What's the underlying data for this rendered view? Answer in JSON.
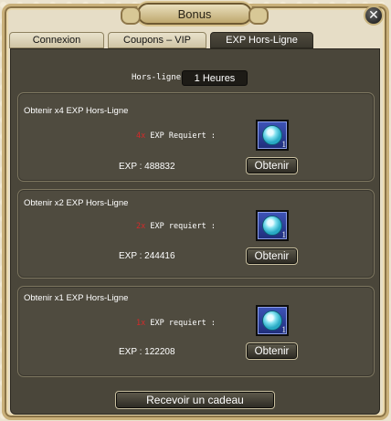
{
  "window": {
    "title": "Bonus",
    "close_icon": "close-icon"
  },
  "tabs": [
    {
      "label": "Connexion",
      "active": false
    },
    {
      "label": "Coupons – VIP",
      "active": false
    },
    {
      "label": "EXP Hors-Ligne",
      "active": true
    }
  ],
  "hours": {
    "label": "Hors-ligne",
    "value": "1 Heures"
  },
  "offers": [
    {
      "title": "Obtenir x4 EXP Hors-Ligne",
      "req_num": "4x",
      "req_text": "EXP Requiert :",
      "exp_text": "EXP : 488832",
      "item_qty": "1",
      "button": "Obtenir"
    },
    {
      "title": "Obtenir x2 EXP Hors-Ligne",
      "req_num": "2x",
      "req_text": "EXP requiert :",
      "exp_text": "EXP : 244416",
      "item_qty": "1",
      "button": "Obtenir"
    },
    {
      "title": "Obtenir x1 EXP Hors-Ligne",
      "req_num": "1x",
      "req_text": "EXP requiert :",
      "exp_text": "EXP : 122208",
      "item_qty": "1",
      "button": "Obtenir"
    }
  ],
  "footer_button": "Recevoir un cadeau",
  "colors": {
    "panel": "#4a463a",
    "active_tab": "#3a372e",
    "required_number": "#d42a2a"
  }
}
